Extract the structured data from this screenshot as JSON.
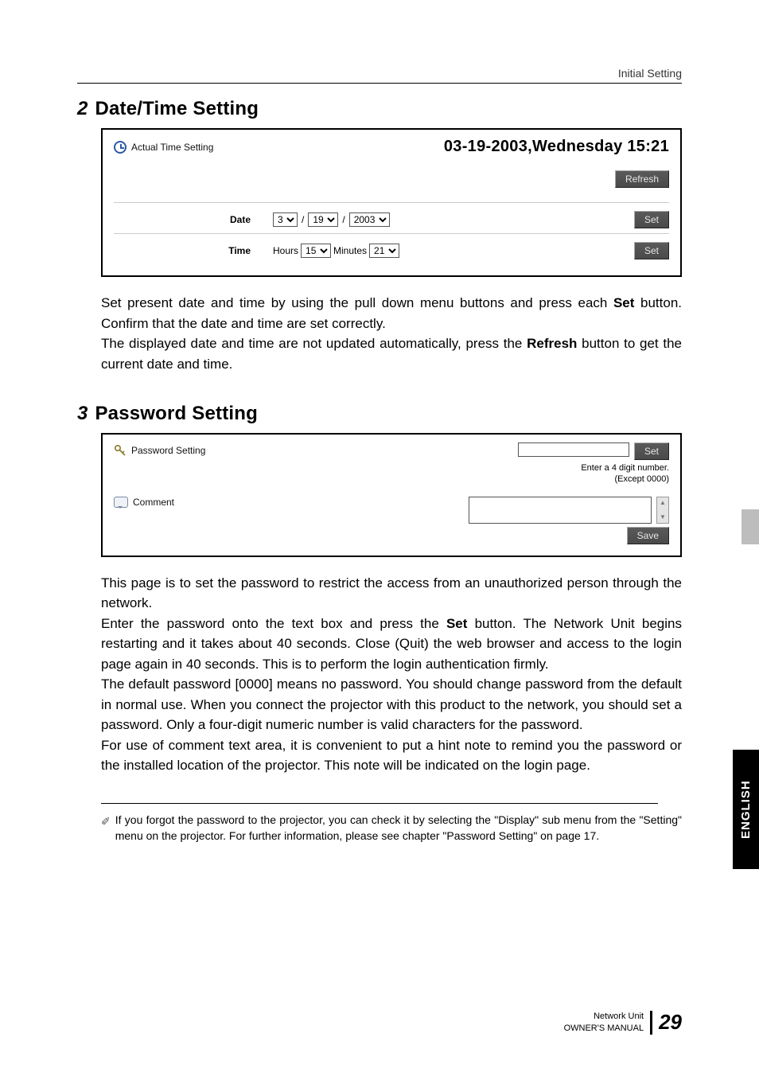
{
  "header": {
    "section_label": "Initial Setting"
  },
  "section2": {
    "number": "2",
    "title": "Date/Time Setting",
    "actual_label": "Actual Time Setting",
    "datetime_display": "03-19-2003,Wednesday 15:21",
    "refresh_label": "Refresh",
    "date_label": "Date",
    "time_label": "Time",
    "hours_label": "Hours",
    "minutes_label": "Minutes",
    "set_label": "Set",
    "date_month": "3",
    "date_day": "19",
    "date_year": "2003",
    "time_hours": "15",
    "time_minutes": "21",
    "body_p1": "Set present date and time by using the pull down menu buttons and press each ",
    "body_p1_bold": "Set",
    "body_p1_after": " button. Confirm that the date and time are set correctly.",
    "body_p2_before": "The displayed date and time are not updated automatically, press the ",
    "body_p2_bold": "Refresh",
    "body_p2_after": " button to get the current date and time."
  },
  "section3": {
    "number": "3",
    "title": "Password Setting",
    "pw_label": "Password Setting",
    "set_label": "Set",
    "hint_line1": "Enter a 4 digit number.",
    "hint_line2": "(Except 0000)",
    "comment_label": "Comment",
    "save_label": "Save",
    "body_p1": "This page is to set the password to restrict the access from an unauthorized person through the network.",
    "body_p2_before": "Enter the password onto the text box and press the ",
    "body_p2_bold": "Set",
    "body_p2_after": " button. The Network Unit begins restarting and it takes about 40 seconds. Close (Quit) the web browser and access to the login page again in 40 seconds. This is to perform the login authentication firmly.",
    "body_p3": "The default password [0000] means no password. You should change password from the default in normal use. When you connect the projector with this product to the network, you should set a password. Only a four-digit numeric number is valid characters for the password.",
    "body_p4": "For use of comment text area, it is convenient to put a hint note to remind you the password or the installed location of the projector. This note will be indicated on the login page."
  },
  "footnote": {
    "text": "If you forgot the password to the projector, you can check it by selecting the \"Display\" sub menu from the \"Setting\" menu on the projector. For further information, please see chapter \"Password Setting\" on page 17."
  },
  "footer": {
    "line1": "Network Unit",
    "line2": "OWNER'S MANUAL",
    "page": "29"
  },
  "side_tab": "ENGLISH"
}
